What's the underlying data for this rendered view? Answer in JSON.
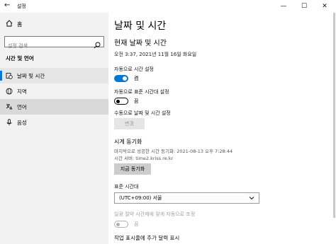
{
  "window": {
    "title": "설정",
    "back_glyph": "←",
    "min_glyph": "—",
    "max_glyph": "☐",
    "close_glyph": "✕"
  },
  "sidebar": {
    "home_label": "홈",
    "search_placeholder": "설정 검색",
    "section_title": "시간 및 언어",
    "items": [
      {
        "label": "날짜 및 시간",
        "icon": "calendar-clock-icon"
      },
      {
        "label": "지역",
        "icon": "globe-icon"
      },
      {
        "label": "언어",
        "icon": "language-icon"
      },
      {
        "label": "음성",
        "icon": "microphone-icon"
      }
    ],
    "accent": "#0078d4"
  },
  "main": {
    "page_title": "날짜 및 시간",
    "subheader": "현재 날짜 및 시간",
    "current_datetime": "오전 3:37, 2021년 11월 16일 화요일",
    "auto_time_label": "자동으로 시간 설정",
    "auto_time_state": "켬",
    "auto_tz_label": "자동으로 표준 시간대 설정",
    "auto_tz_state": "끔",
    "manual_label": "수동으로 날짜 및 시간 설정",
    "change_button": "변경",
    "sync_header": "시계 동기화",
    "last_sync": "마지막으로 성공한 시간 동기화: 2021-08-13 오후 7:28:44",
    "time_server": "시간 서버: time2.kriss.re.kr",
    "sync_button": "지금 동기화",
    "tz_header": "표준 시간대",
    "tz_value": "(UTC+09:00) 서울",
    "dst_label": "일광 절약 시간제에 맞게 자동으로 조정",
    "dst_state": "끔",
    "taskbar_label": "작업 표시줄에 추가 달력 표시"
  }
}
